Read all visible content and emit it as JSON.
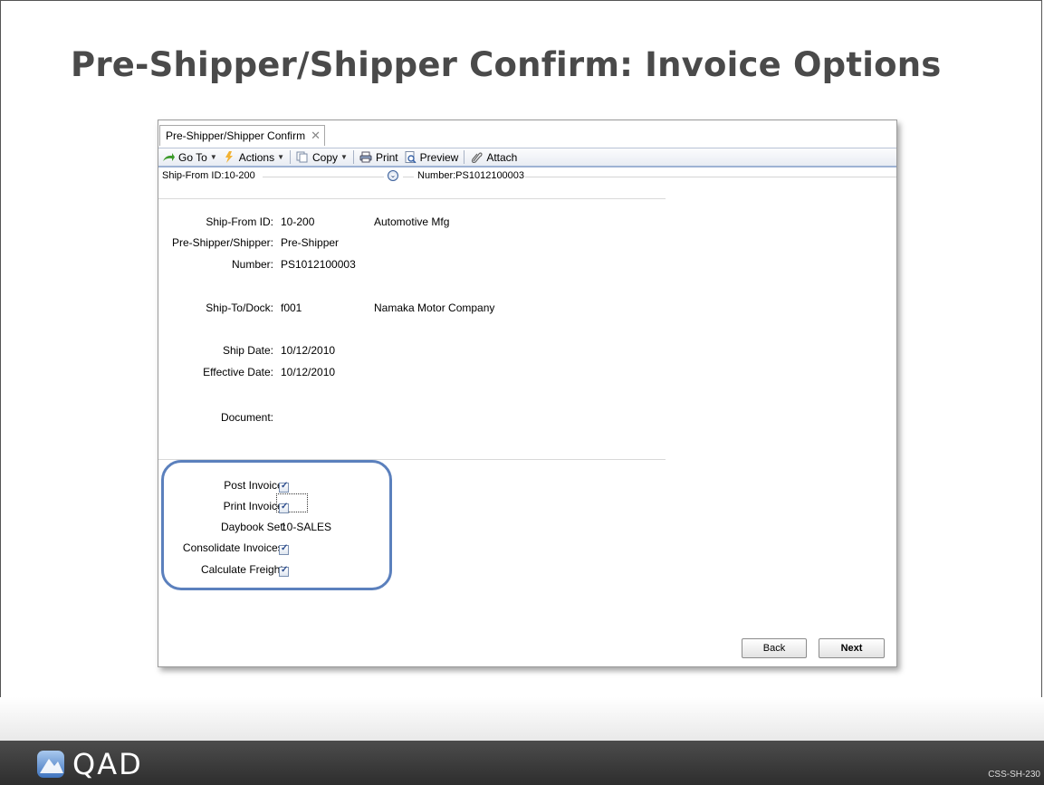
{
  "slide": {
    "title": "Pre-Shipper/Shipper Confirm: Invoice Options",
    "footer_logo_text": "QAD",
    "footer_code": "CSS-SH-230"
  },
  "window": {
    "tab_label": "Pre-Shipper/Shipper Confirm",
    "tab_close": "✕",
    "toolbar": {
      "goto": "Go To",
      "actions": "Actions",
      "copy": "Copy",
      "print": "Print",
      "preview": "Preview",
      "attach": "Attach"
    },
    "header": {
      "ship_from": "Ship-From ID:10-200",
      "number": "Number:PS1012100003"
    },
    "fields": {
      "ship_from_label": "Ship-From ID:",
      "ship_from_value": "10-200",
      "ship_from_desc": "Automotive Mfg",
      "pre_shipper_label": "Pre-Shipper/Shipper:",
      "pre_shipper_value": "Pre-Shipper",
      "number_label": "Number:",
      "number_value": "PS1012100003",
      "ship_to_label": "Ship-To/Dock:",
      "ship_to_value": "f001",
      "ship_to_desc": "Namaka Motor Company",
      "ship_date_label": "Ship Date:",
      "ship_date_value": "10/12/2010",
      "effective_date_label": "Effective Date:",
      "effective_date_value": "10/12/2010",
      "document_label": "Document:"
    },
    "invoice_options": {
      "post_invoice_label": "Post Invoice:",
      "post_invoice_checked": true,
      "print_invoice_label": "Print Invoice:",
      "print_invoice_checked": true,
      "daybook_set_label": "Daybook Set:",
      "daybook_set_value": "10-SALES",
      "consolidate_label": "Consolidate Invoices:",
      "consolidate_checked": true,
      "calc_freight_label": "Calculate Freight:",
      "calc_freight_checked": true
    },
    "buttons": {
      "back": "Back",
      "next": "Next"
    }
  },
  "colors": {
    "highlight": "#5b80bd",
    "title": "#4a4a4a",
    "footer": "#3a3a3a"
  }
}
